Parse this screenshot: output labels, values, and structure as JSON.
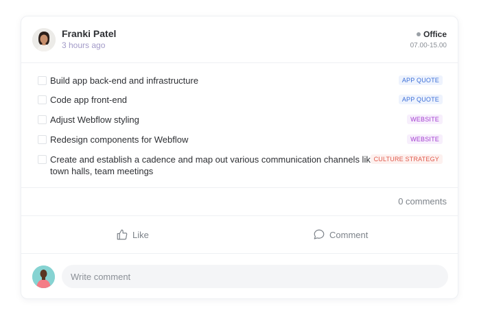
{
  "post": {
    "author_name": "Franki Patel",
    "time_ago": "3 hours ago",
    "location": "Office",
    "hours": "07.00-15.00"
  },
  "tasks": [
    {
      "text": "Build app back-end and infrastructure",
      "tag": "APP QUOTE",
      "tag_color": "#3b6fd8"
    },
    {
      "text": "Code app front-end",
      "tag": "APP QUOTE",
      "tag_color": "#3b6fd8"
    },
    {
      "text": "Adjust Webflow styling",
      "tag": "WEBSITE",
      "tag_color": "#a23bd0"
    },
    {
      "text": "Redesign components for Webflow",
      "tag": "WEBSITE",
      "tag_color": "#a23bd0"
    },
    {
      "text_line1": "Create and establish a cadence and map out various communication channels like",
      "text_line2": "town halls, team meetings",
      "tag": "CULTURE STRATEGY",
      "tag_color": "#e0584a"
    }
  ],
  "comments_count": "0 comments",
  "actions": {
    "like_label": "Like",
    "comment_label": "Comment"
  },
  "compose": {
    "placeholder": "Write comment"
  },
  "icons": {
    "author_avatar": "avatar-woman",
    "user_avatar": "avatar-man",
    "location": "dot-icon",
    "like": "thumbs-up-icon",
    "comment": "speech-bubble-icon"
  }
}
